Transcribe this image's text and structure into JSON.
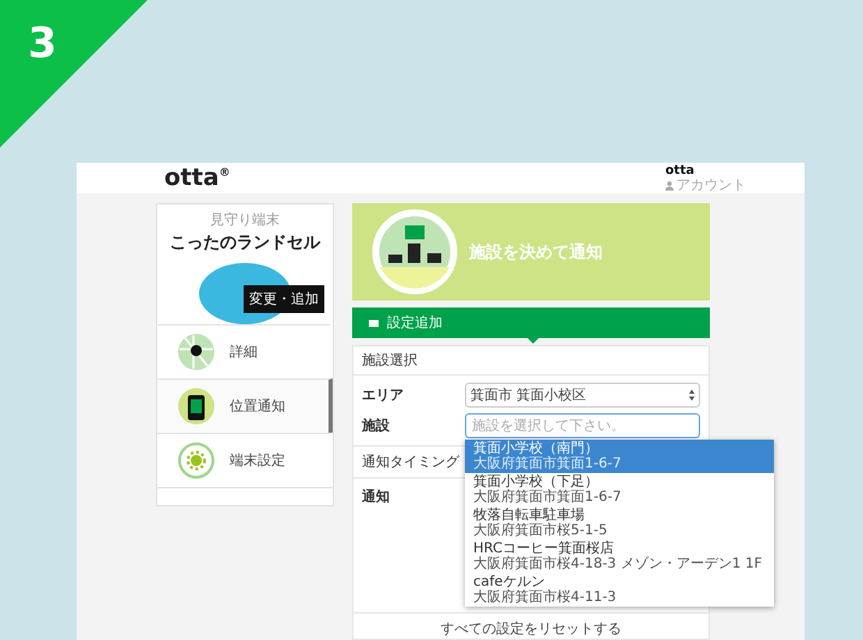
{
  "badge": {
    "number": "3"
  },
  "header": {
    "logo": "otta$^{®}$",
    "user_name": "otta",
    "account_link": "アカウント"
  },
  "device": {
    "caption": "見守り端末",
    "name": "こったのランドセル",
    "button": "変更・追加"
  },
  "menu": [
    {
      "label": "詳細",
      "kind": "map",
      "selected": false
    },
    {
      "label": "位置通知",
      "kind": "phone",
      "selected": true
    },
    {
      "label": "端末設定",
      "kind": "gear",
      "selected": false
    }
  ],
  "banner": {
    "title": "施設を決めて通知"
  },
  "section_bar": {
    "label": "設定追加"
  },
  "form": {
    "heading": "施設選択",
    "area_label": "エリア",
    "area_value": "箕面市 箕面小校区",
    "facility_label": "施設",
    "facility_placeholder": "施設を選択して下さい。",
    "timing_label": "通知タイミング",
    "notify_label": "通知",
    "reset": "すべての設定をリセットする"
  },
  "dropdown": [
    {
      "name": "箕面小学校（南門）",
      "address": "大阪府箕面市箕面1-6-7",
      "selected": true
    },
    {
      "name": "箕面小学校（下足）",
      "address": "大阪府箕面市箕面1-6-7",
      "selected": false
    },
    {
      "name": "牧落自転車駐車場",
      "address": "大阪府箕面市桜5-1-5",
      "selected": false
    },
    {
      "name": "HRCコーヒー箕面桜店",
      "address": "大阪府箕面市桜4-18-3 メゾン・アーデン1 1F",
      "selected": false
    },
    {
      "name": "cafeケルン",
      "address": "大阪府箕面市桜4-11-3",
      "selected": false
    }
  ]
}
